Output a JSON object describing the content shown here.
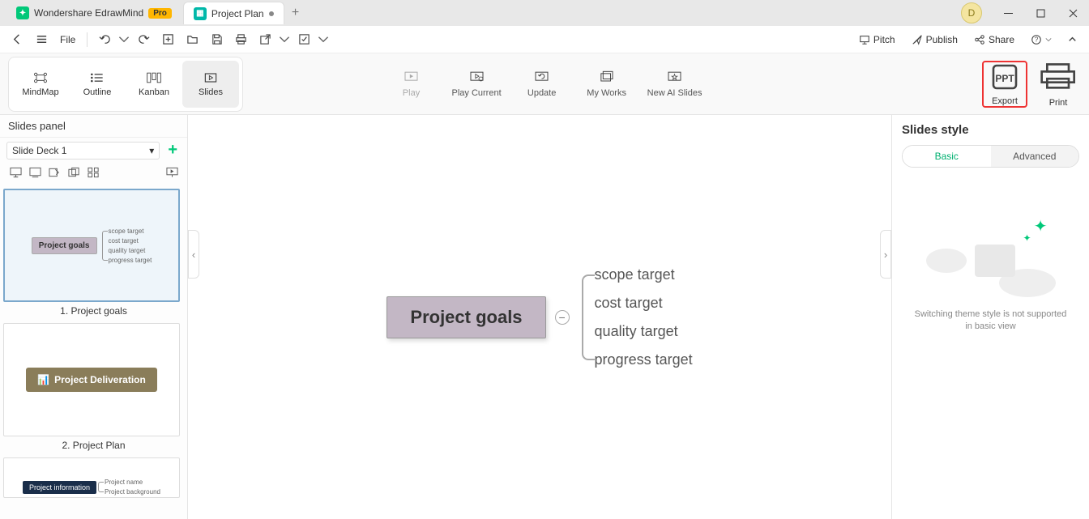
{
  "titlebar": {
    "app_name": "Wondershare EdrawMind",
    "badge": "Pro",
    "file_tab": "Project Plan",
    "user_initial": "D"
  },
  "toolbar": {
    "file": "File",
    "pitch": "Pitch",
    "publish": "Publish",
    "share": "Share"
  },
  "views": {
    "mindmap": "MindMap",
    "outline": "Outline",
    "kanban": "Kanban",
    "slides": "Slides"
  },
  "ribbon": {
    "play": "Play",
    "play_current": "Play Current",
    "update": "Update",
    "my_works": "My Works",
    "new_ai": "New AI Slides",
    "export": "Export",
    "print": "Print"
  },
  "slides_panel": {
    "title": "Slides panel",
    "deck": "Slide Deck 1",
    "thumb1": {
      "root": "Project goals",
      "items": [
        "scope target",
        "cost target",
        "quality target",
        "progress target"
      ],
      "caption": "1. Project goals"
    },
    "thumb2": {
      "root": "Project Deliveration",
      "caption": "2. Project Plan"
    },
    "thumb3": {
      "root": "Project information",
      "items": [
        "Project name",
        "Project background"
      ]
    }
  },
  "canvas": {
    "root": "Project goals",
    "children": [
      "scope target",
      "cost target",
      "quality target",
      "progress target"
    ]
  },
  "style_panel": {
    "title": "Slides style",
    "tab_basic": "Basic",
    "tab_advanced": "Advanced",
    "message": "Switching theme style is not supported in basic view"
  }
}
